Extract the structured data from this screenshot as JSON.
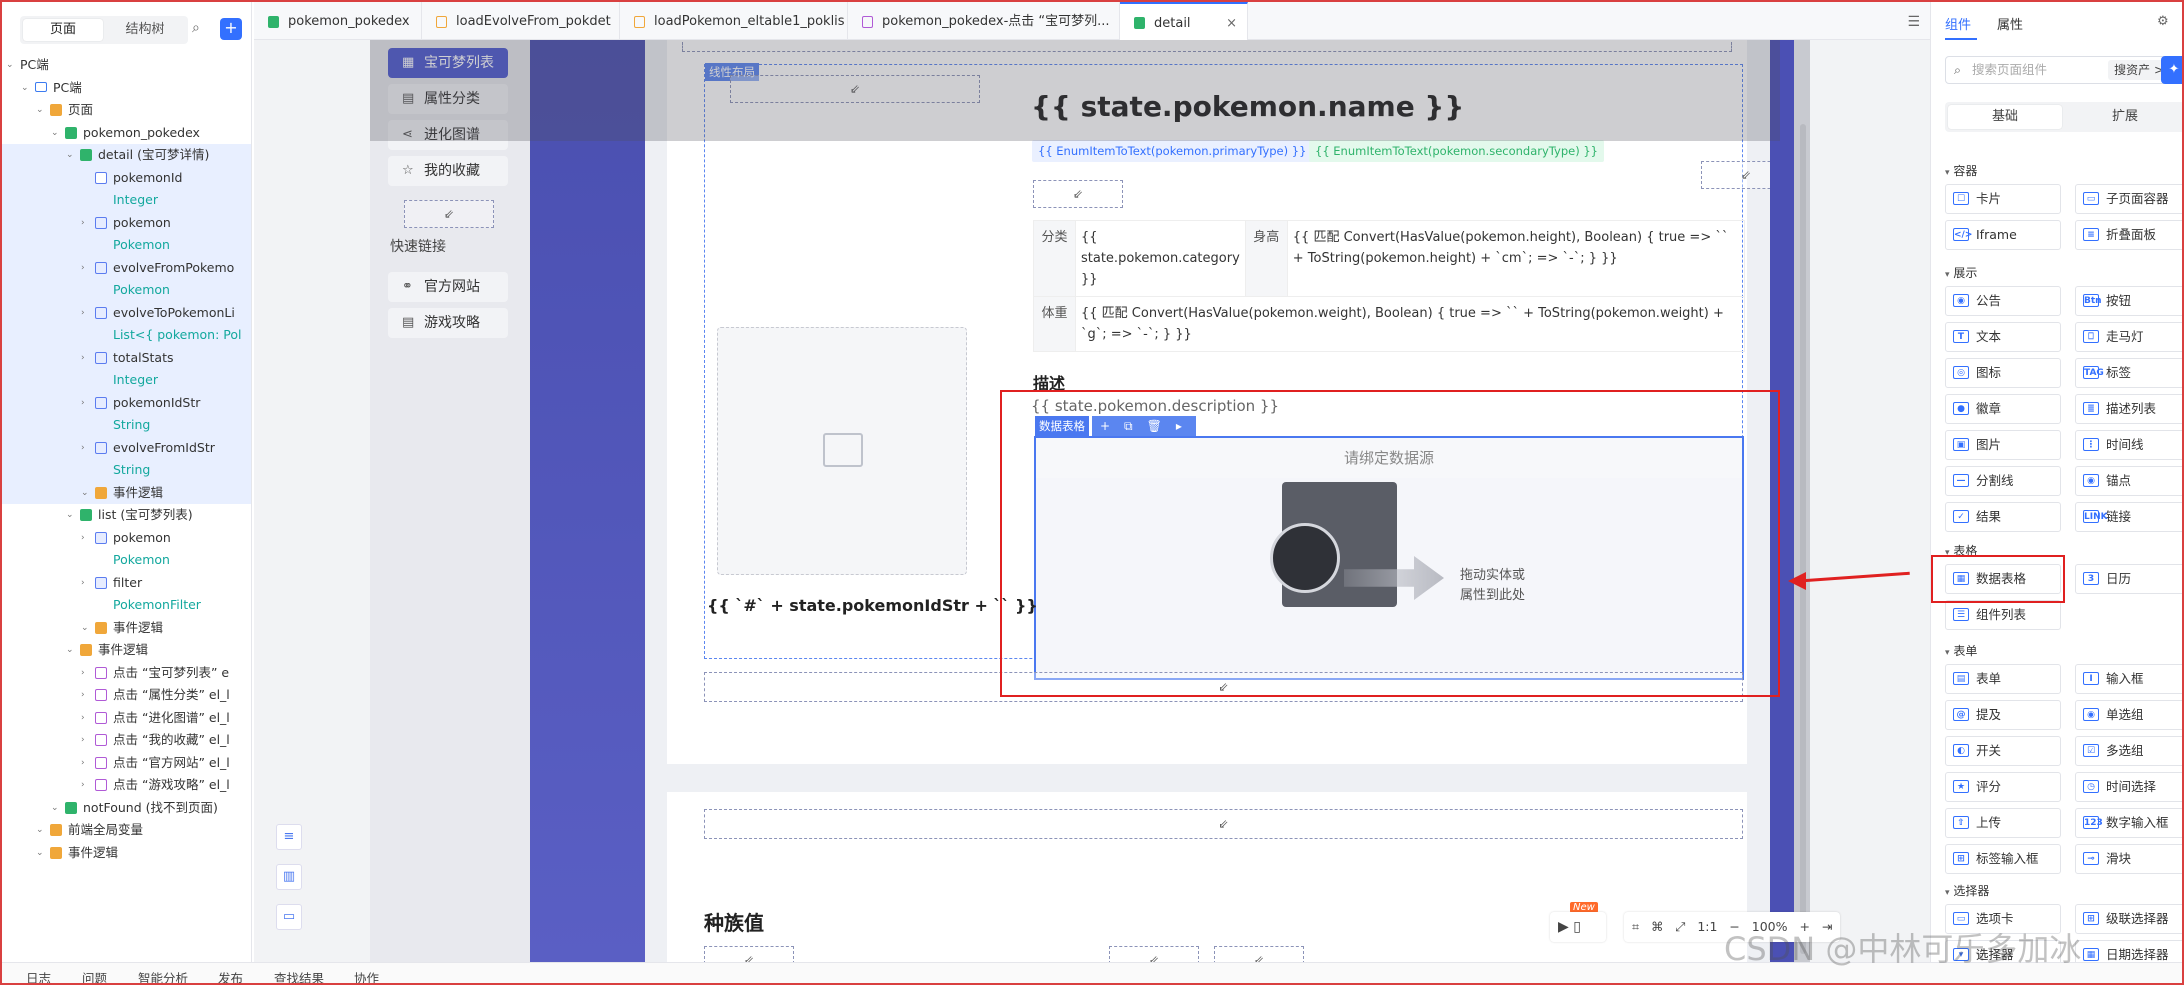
{
  "left": {
    "tab_page": "页面",
    "tab_tree": "结构树",
    "tree": [
      {
        "label": "PC端",
        "level": 0,
        "icon": "caret",
        "sub": ""
      },
      {
        "label": "PC端",
        "level": 1,
        "icon": "pc",
        "sub": ""
      },
      {
        "label": "页面",
        "level": 2,
        "icon": "folder",
        "sub": ""
      },
      {
        "label": "pokemon_pokedex",
        "level": 3,
        "icon": "green",
        "sub": ""
      },
      {
        "label": "detail (宝可梦详情)",
        "level": 4,
        "icon": "green",
        "sub": "",
        "selected": true
      },
      {
        "label": "pokemonId",
        "level": 5,
        "icon": "arrow",
        "sub": "Integer"
      },
      {
        "label": "pokemon",
        "level": 5,
        "icon": "blue",
        "sub": "Pokemon"
      },
      {
        "label": "evolveFromPokemo",
        "level": 5,
        "icon": "blue",
        "sub": "Pokemon"
      },
      {
        "label": "evolveToPokemonLi",
        "level": 5,
        "icon": "blue",
        "sub": "List<{ pokemon: Pol"
      },
      {
        "label": "totalStats",
        "level": 5,
        "icon": "blue",
        "sub": "Integer"
      },
      {
        "label": "pokemonIdStr",
        "level": 5,
        "icon": "blue",
        "sub": "String"
      },
      {
        "label": "evolveFromIdStr",
        "level": 5,
        "icon": "blue",
        "sub": "String"
      },
      {
        "label": "事件逻辑",
        "level": 5,
        "icon": "folder",
        "sub": ""
      },
      {
        "label": "list (宝可梦列表)",
        "level": 4,
        "icon": "green",
        "sub": ""
      },
      {
        "label": "pokemon",
        "level": 5,
        "icon": "blue",
        "sub": "Pokemon"
      },
      {
        "label": "filter",
        "level": 5,
        "icon": "blue",
        "sub": "PokemonFilter"
      },
      {
        "label": "事件逻辑",
        "level": 5,
        "icon": "folder",
        "sub": ""
      },
      {
        "label": "事件逻辑",
        "level": 4,
        "icon": "folder",
        "sub": ""
      },
      {
        "label": "点击 “宝可梦列表” e",
        "level": 5,
        "icon": "event",
        "sub": ""
      },
      {
        "label": "点击 “属性分类” el_l",
        "level": 5,
        "icon": "event",
        "sub": ""
      },
      {
        "label": "点击 “进化图谱” el_l",
        "level": 5,
        "icon": "event",
        "sub": ""
      },
      {
        "label": "点击 “我的收藏” el_l",
        "level": 5,
        "icon": "event",
        "sub": ""
      },
      {
        "label": "点击 “官方网站” el_l",
        "level": 5,
        "icon": "event",
        "sub": ""
      },
      {
        "label": "点击 “游戏攻略” el_l",
        "level": 5,
        "icon": "event",
        "sub": ""
      },
      {
        "label": "notFound (找不到页面)",
        "level": 3,
        "icon": "green",
        "sub": ""
      },
      {
        "label": "前端全局变量",
        "level": 2,
        "icon": "folder",
        "sub": ""
      },
      {
        "label": "事件逻辑",
        "level": 2,
        "icon": "folder",
        "sub": ""
      }
    ]
  },
  "tabs": [
    {
      "label": "pokemon_pokedex",
      "active": false
    },
    {
      "label": "loadEvolveFrom_pokdet",
      "active": false
    },
    {
      "label": "loadPokemon_eltable1_poklis",
      "active": false
    },
    {
      "label": "pokemon_pokedex-点击 “宝可梦列...",
      "active": false
    },
    {
      "label": "detail",
      "active": true
    }
  ],
  "app_sidebar": {
    "nav": [
      "宝可梦列表",
      "属性分类",
      "进化图谱",
      "我的收藏"
    ],
    "quick_links_title": "快速链接",
    "links": [
      "官方网站",
      "游戏攻略"
    ]
  },
  "detail": {
    "layout_label": "线性布局",
    "name_expr": "{{ state.pokemon.name }}",
    "primary_type": "{{ EnumItemToText(pokemon.primaryType) }}",
    "secondary_type": "{{ EnumItemToText(pokemon.secondaryType) }}",
    "rows": [
      {
        "h1": "分类",
        "v1": "{{ state.pokemon.category }}",
        "h2": "身高",
        "v2": "{{ 匹配 Convert(HasValue(pokemon.height), Boolean) { true =>  `` + ToString(pokemon.height) + `cm`;  =>  `-`; } }}"
      },
      {
        "h1": "体重",
        "v1": "{{ 匹配 Convert(HasValue(pokemon.weight), Boolean) { true =>  `` + ToString(pokemon.weight) + `g`;  =>  `-`; } }}"
      }
    ],
    "description_title": "描述",
    "description_expr": "{{ state.pokemon.description }}",
    "data_table_label": "数据表格",
    "bind_source": "请绑定数据源",
    "drag_hint_line1": "拖动实体或",
    "drag_hint_line2": "属性到此处",
    "id_expr": "{{ `#` + state.pokemonIdStr + `` }}",
    "stats_title": "种族值"
  },
  "zoom": {
    "ratio": "1:1",
    "level": "100%",
    "new_badge": "New"
  },
  "right": {
    "tab_components": "组件",
    "tab_properties": "属性",
    "search_placeholder": "搜索页面组件",
    "search_assets": "搜资产 >",
    "seg_basic": "基础",
    "seg_ext": "扩展",
    "categories": [
      {
        "title": "容器",
        "items": [
          [
            "卡片",
            "☐"
          ],
          [
            "子页面容器",
            "▭"
          ],
          [
            "Iframe",
            "</>"
          ],
          [
            "折叠面板",
            "≡"
          ]
        ]
      },
      {
        "title": "展示",
        "items": [
          [
            "公告",
            "◉"
          ],
          [
            "按钮",
            "Btn"
          ],
          [
            "文本",
            "T"
          ],
          [
            "走马灯",
            "⎕"
          ],
          [
            "图标",
            "◎"
          ],
          [
            "标签",
            "TAG"
          ],
          [
            "徽章",
            "●"
          ],
          [
            "描述列表",
            "≣"
          ],
          [
            "图片",
            "▣"
          ],
          [
            "时间线",
            "⋮"
          ],
          [
            "分割线",
            "—"
          ],
          [
            "锚点",
            "◉"
          ],
          [
            "结果",
            "✓"
          ],
          [
            "链接",
            "LINK"
          ]
        ]
      },
      {
        "title": "表格",
        "items": [
          [
            "数据表格",
            "▦"
          ],
          [
            "日历",
            "3"
          ],
          [
            "组件列表",
            "☰"
          ]
        ]
      },
      {
        "title": "表单",
        "items": [
          [
            "表单",
            "▤"
          ],
          [
            "输入框",
            "I"
          ],
          [
            "提及",
            "@"
          ],
          [
            "单选组",
            "◉"
          ],
          [
            "开关",
            "◐"
          ],
          [
            "多选组",
            "☑"
          ],
          [
            "评分",
            "★"
          ],
          [
            "时间选择",
            "◷"
          ],
          [
            "上传",
            "⇧"
          ],
          [
            "数字输入框",
            "123"
          ],
          [
            "标签输入框",
            "⊞"
          ],
          [
            "滑块",
            "⊸"
          ]
        ]
      },
      {
        "title": "选择器",
        "items": [
          [
            "选项卡",
            "▭"
          ],
          [
            "级联选择器",
            "⊞"
          ],
          [
            "选择器",
            "▾"
          ],
          [
            "日期选择器",
            "▦"
          ]
        ]
      }
    ]
  },
  "bottom": [
    "日志",
    "问题",
    "智能分析",
    "发布",
    "查找结果",
    "协作"
  ],
  "watermark": "CSDN @中林可乐多加冰"
}
